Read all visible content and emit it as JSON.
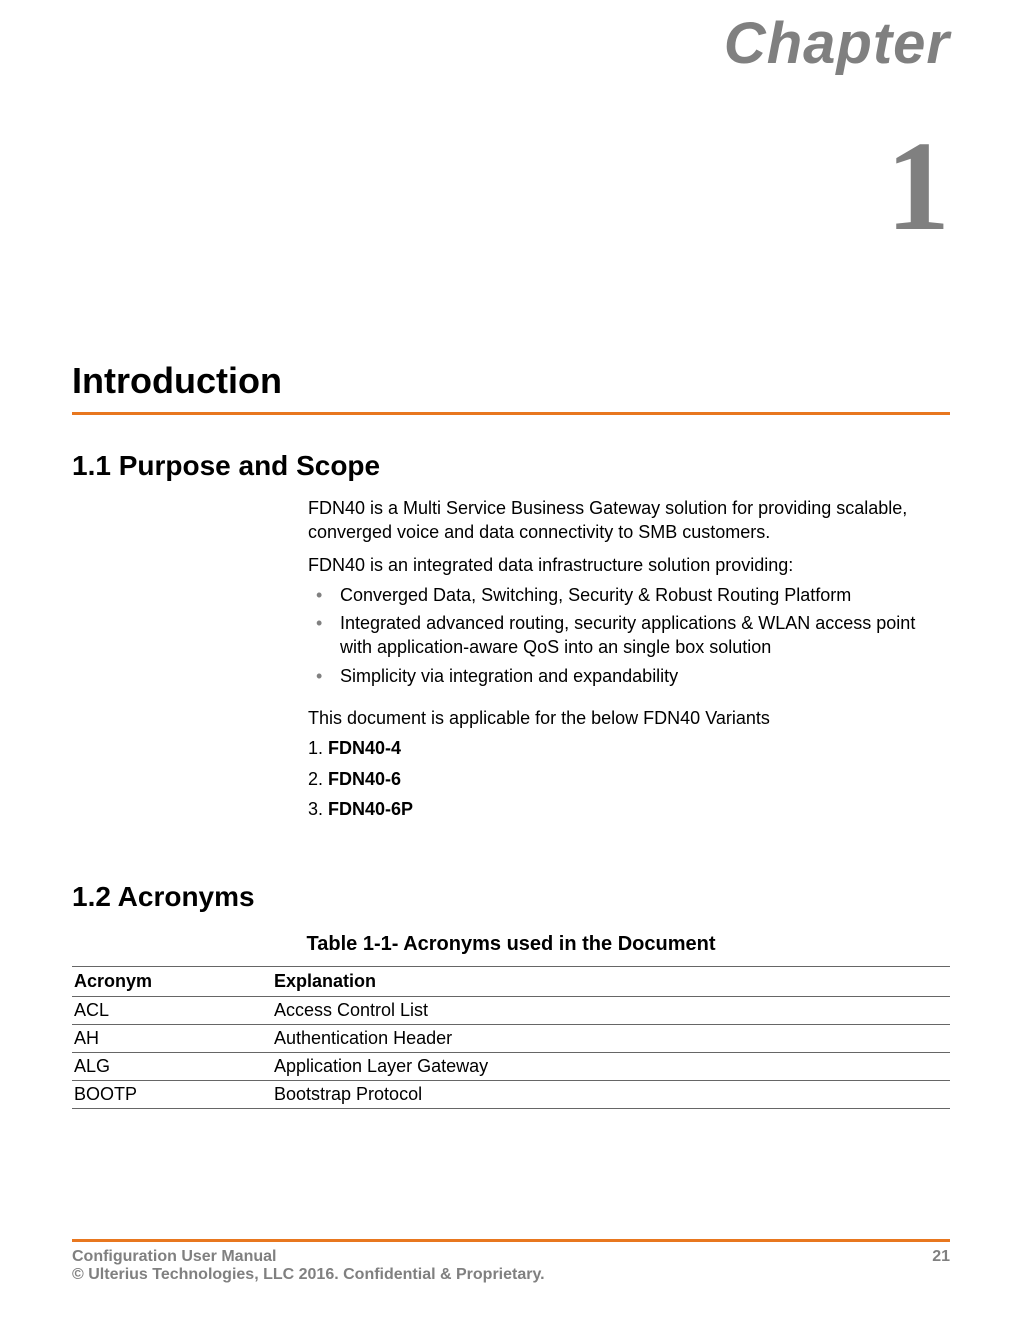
{
  "chapter": {
    "label": "Chapter",
    "number": "1"
  },
  "h1": "Introduction",
  "sec1": {
    "heading": "1.1 Purpose and Scope",
    "p1": "FDN40 is a Multi Service Business Gateway solution for providing scalable, converged voice and data connectivity to SMB customers.",
    "p2": "FDN40 is an integrated data infrastructure solution providing:",
    "bullets": {
      "0": "Converged Data, Switching, Security & Robust Routing Platform",
      "1": "Integrated advanced routing, security applications & WLAN access point with application-aware QoS into an single box solution",
      "2": " Simplicity via integration and expandability"
    },
    "p3": "This document is applicable for the below FDN40 Variants",
    "variants": {
      "0": {
        "num": "1. ",
        "name": "FDN40-4"
      },
      "1": {
        "num": "2. ",
        "name": "FDN40-6"
      },
      "2": {
        "num": "3. ",
        "name": "FDN40-6P"
      }
    }
  },
  "sec2": {
    "heading": "1.2 Acronyms",
    "table_caption": "Table 1-1- Acronyms used in the Document",
    "headers": {
      "col1": "Acronym",
      "col2": "Explanation"
    },
    "rows": {
      "0": {
        "a": "ACL",
        "e": "Access Control List"
      },
      "1": {
        "a": "AH",
        "e": "Authentication Header"
      },
      "2": {
        "a": "ALG",
        "e": "Application Layer Gateway"
      },
      "3": {
        "a": "BOOTP",
        "e": "Bootstrap Protocol"
      }
    }
  },
  "footer": {
    "left": "Configuration User Manual",
    "page": "21",
    "copyright": "© Ulterius Technologies, LLC 2016. Confidential & Proprietary."
  }
}
